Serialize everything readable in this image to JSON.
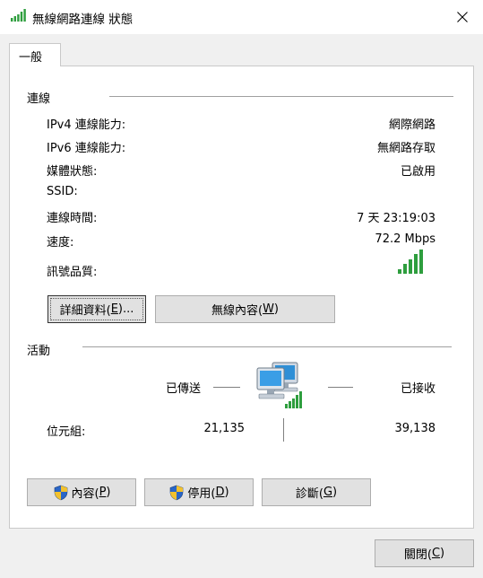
{
  "window": {
    "title": "無線網路連線 狀態",
    "close_icon": "close-icon"
  },
  "tabs": [
    {
      "label": "一般"
    }
  ],
  "connection": {
    "section_title": "連線",
    "rows": [
      {
        "label": "IPv4 連線能力:",
        "value": "網際網路"
      },
      {
        "label": "IPv6 連線能力:",
        "value": "無網路存取"
      },
      {
        "label": "媒體狀態:",
        "value": "已啟用"
      },
      {
        "label": "SSID:",
        "value": ""
      },
      {
        "label": "連線時間:",
        "value": "7 天 23:19:03"
      },
      {
        "label": "速度:",
        "value": "72.2 Mbps"
      }
    ],
    "signal_label": "訊號品質:",
    "signal_bars": 5,
    "signal_max_bars": 5,
    "details_button": {
      "text": "詳細資料(",
      "key": "E",
      "suffix": ")..."
    },
    "wireless_props_button": {
      "text": "無線內容(",
      "key": "W",
      "suffix": ")"
    }
  },
  "activity": {
    "section_title": "活動",
    "sent_label": "已傳送",
    "received_label": "已接收",
    "bytes_label": "位元組:",
    "bytes_sent": "21,135",
    "bytes_received": "39,138",
    "buttons": [
      {
        "text": "內容(",
        "key": "P",
        "suffix": ")",
        "icon": "shield-icon"
      },
      {
        "text": "停用(",
        "key": "D",
        "suffix": ")",
        "icon": "shield-icon"
      },
      {
        "text": "診斷(",
        "key": "G",
        "suffix": ")"
      }
    ]
  },
  "footer": {
    "close_button": {
      "text": "關閉(",
      "key": "C",
      "suffix": ")"
    }
  },
  "colors": {
    "signal_green": "#2e9e3e",
    "background": "#f0f0f0",
    "button_face": "#e1e1e1"
  }
}
